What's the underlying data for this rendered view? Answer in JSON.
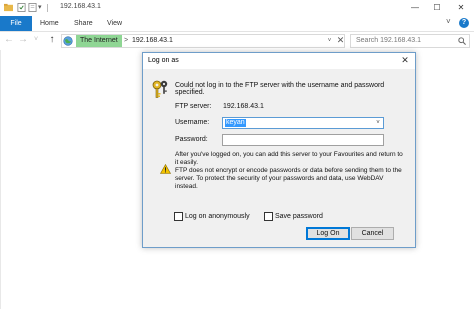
{
  "window": {
    "title": "192.168.43.1",
    "controls": {
      "minimize": "—",
      "maximize": "☐",
      "close": "✕"
    }
  },
  "ribbon": {
    "file": "File",
    "tabs": [
      "Home",
      "Share",
      "View"
    ],
    "help": "?",
    "expand": "˅"
  },
  "nav": {
    "back": "←",
    "forward": "→",
    "recent": "˅",
    "up": "↑",
    "breadcrumb": [
      "The Internet",
      "192.168.43.1"
    ],
    "crumb_sep": ">",
    "dropdown": "˅",
    "clear": "✕",
    "search_placeholder": "Search 192.168.43.1"
  },
  "dialog": {
    "title": "Log on as",
    "close": "✕",
    "message": "Could not log in to the FTP server with the username and password specified.",
    "ftp_server_label": "FTP server:",
    "ftp_server_value": "192.168.43.1",
    "username_label": "Username:",
    "username_value": "keyan",
    "password_label": "Password:",
    "password_value": "",
    "info_line1": "After you've logged on, you can add this server to your Favourites and return to it easily.",
    "info_line2": "FTP does not encrypt or encode passwords or data before sending them to the server. To protect the security of your passwords and data, use WebDAV instead.",
    "log_on_anonymously": "Log on anonymously",
    "save_password": "Save password",
    "log_on_button": "Log On",
    "cancel_button": "Cancel"
  },
  "colors": {
    "accent": "#1979ca",
    "breadcrumb_highlight": "#8fd694",
    "selection": "#3399ff",
    "warning": "#f2c200"
  }
}
